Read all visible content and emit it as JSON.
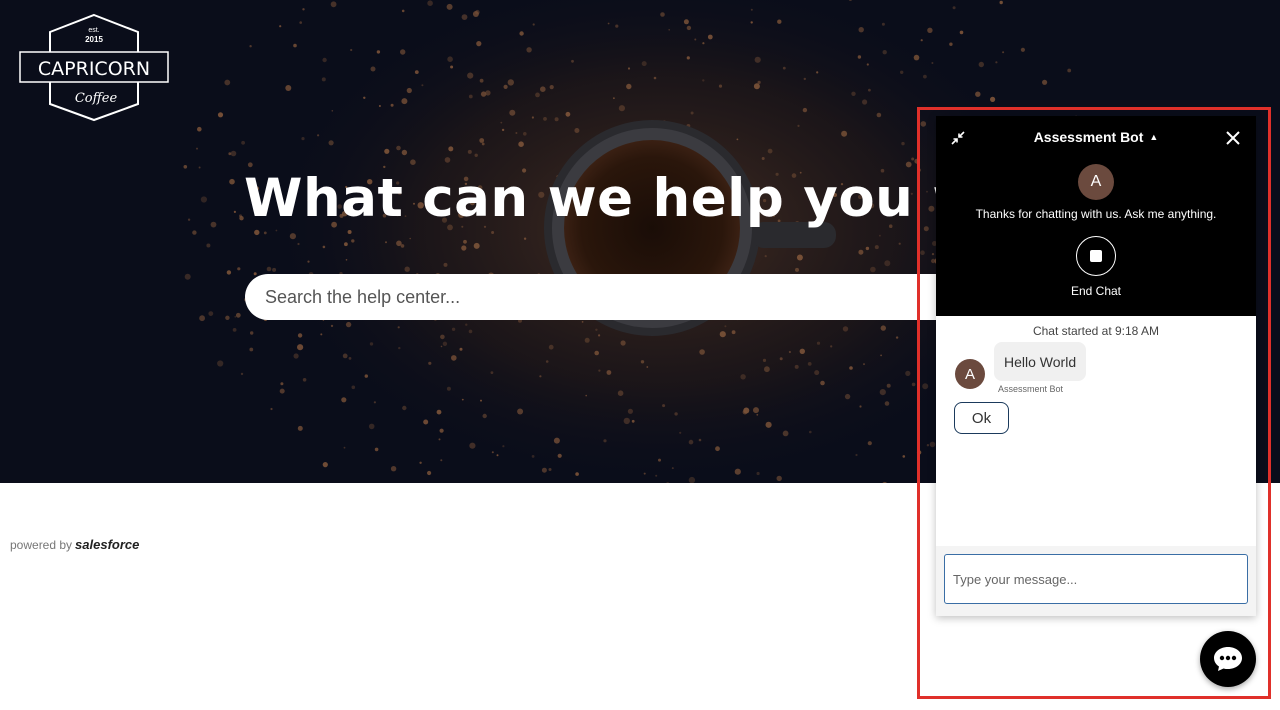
{
  "logo": {
    "top_text": "est.",
    "year": "2015",
    "brand": "CAPRICORN",
    "sub": "Coffee"
  },
  "hero": {
    "title": "What can we help you w",
    "search_placeholder": "Search the help center..."
  },
  "footer": {
    "powered_by": "powered by",
    "brand": "salesforce"
  },
  "chat": {
    "title": "Assessment Bot",
    "avatar_letter": "A",
    "greeting": "Thanks for chatting with us. Ask me anything.",
    "end_chat_label": "End Chat",
    "started_text": "Chat started at 9:18 AM",
    "messages": [
      {
        "text": "Hello World",
        "sender": "Assessment Bot",
        "avatar_letter": "A"
      }
    ],
    "quick_reply": "Ok",
    "input_placeholder": "Type your message...",
    "icons": {
      "minimize": "minimize-icon",
      "close": "close-icon",
      "caret": "caret-up-icon",
      "end_chat": "stop-icon",
      "fab": "chat-bubble-icon"
    }
  },
  "colors": {
    "hero_bg": "#0a0d1a",
    "chat_header_bg": "#000000",
    "avatar_bg": "#6b4a3e",
    "highlight_border": "#e0302a",
    "input_border": "#3a6ea5"
  }
}
